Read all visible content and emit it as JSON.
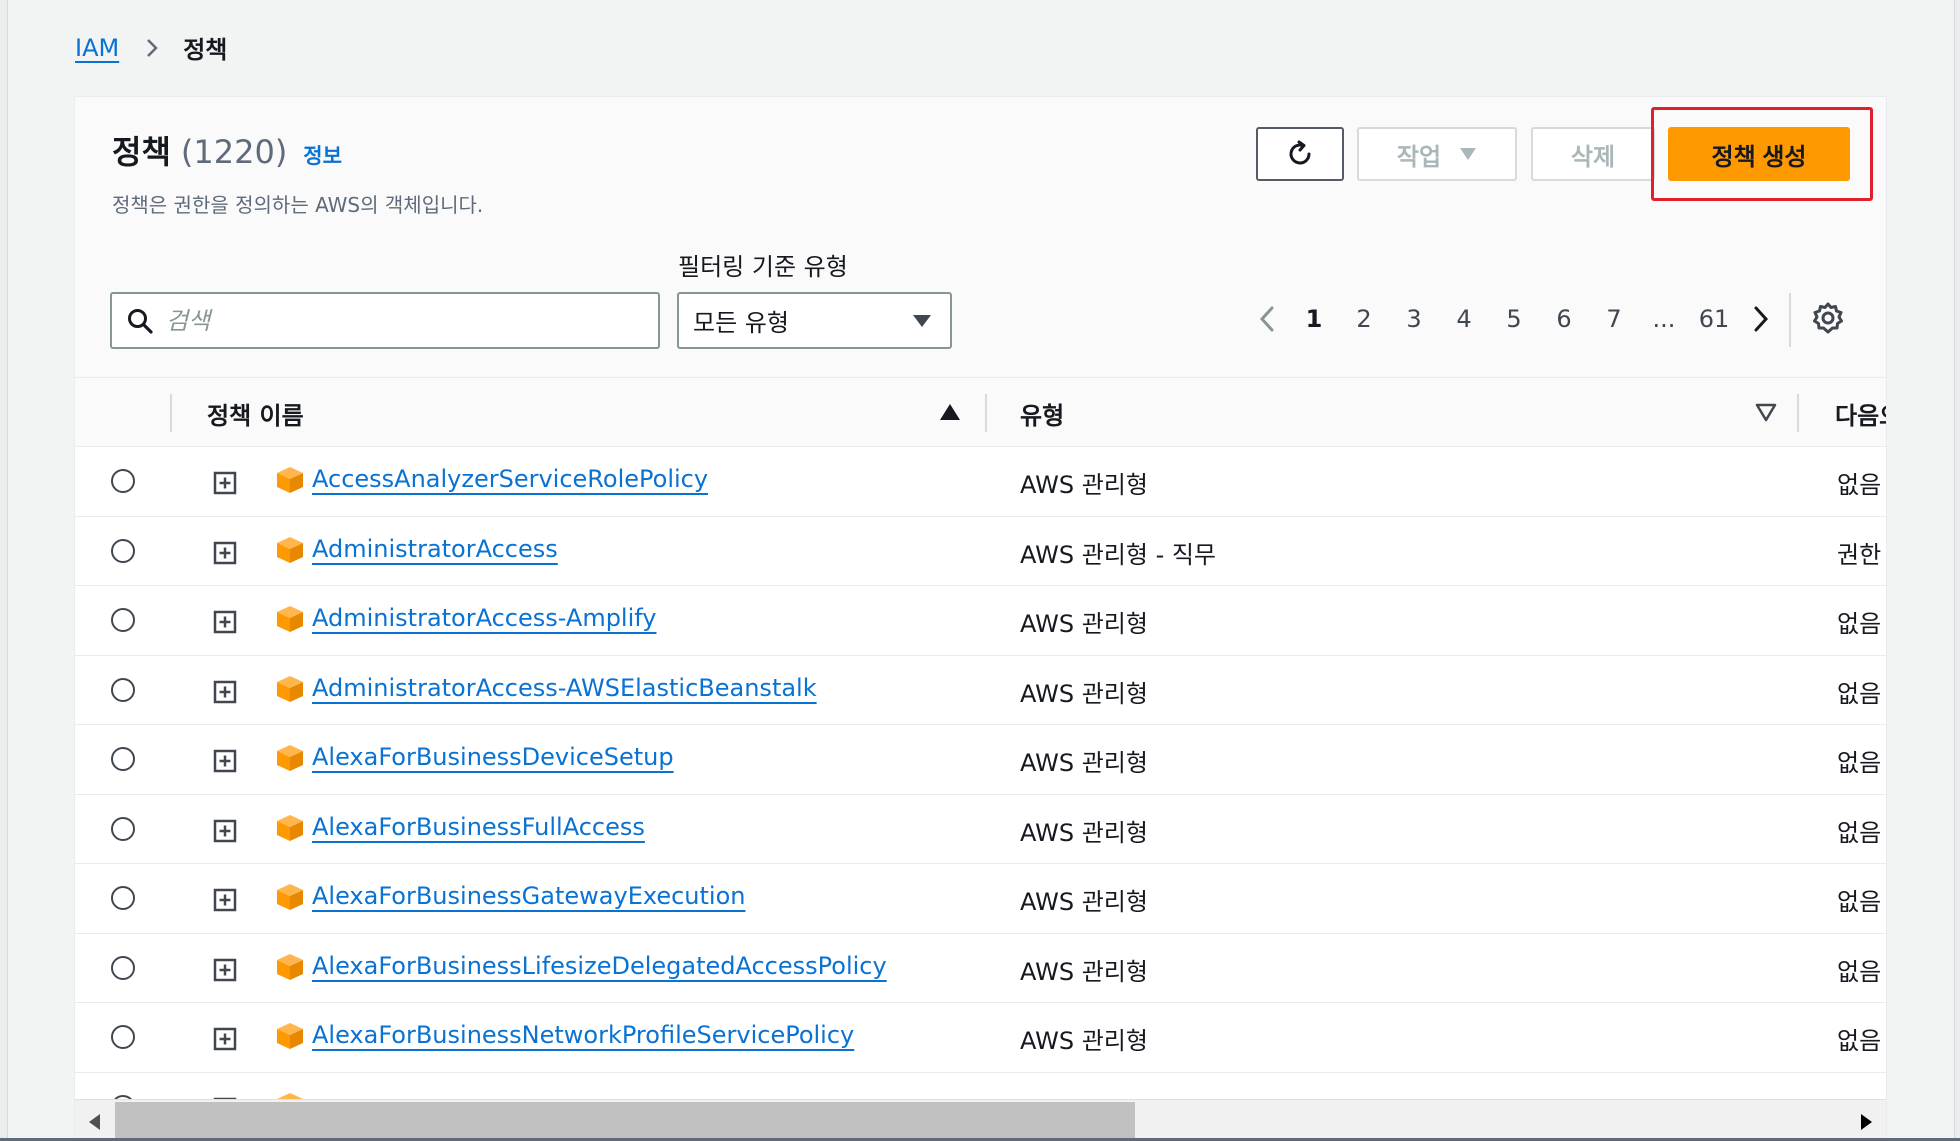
{
  "breadcrumb": {
    "root": "IAM",
    "current": "정책"
  },
  "panel": {
    "title": "정책",
    "count": "(1220)",
    "info_link": "정보",
    "subtitle": "정책은 권한을 정의하는 AWS의 객체입니다."
  },
  "toolbar": {
    "refresh_icon": "refresh-icon",
    "actions_label": "작업",
    "delete_label": "삭제",
    "create_label": "정책 생성"
  },
  "filter": {
    "label": "필터링 기준 유형",
    "search_placeholder": "검색",
    "type_selected": "모든 유형"
  },
  "pagination": {
    "pages": [
      "1",
      "2",
      "3",
      "4",
      "5",
      "6",
      "7",
      "...",
      "61"
    ],
    "current": "1"
  },
  "table": {
    "columns": {
      "name": "정책 이름",
      "type": "유형",
      "used": "다음으"
    },
    "rows": [
      {
        "name": "AccessAnalyzerServiceRolePolicy",
        "type": "AWS 관리형",
        "used": "없음"
      },
      {
        "name": "AdministratorAccess",
        "type": "AWS 관리형 - 직무",
        "used": "권한"
      },
      {
        "name": "AdministratorAccess-Amplify",
        "type": "AWS 관리형",
        "used": "없음"
      },
      {
        "name": "AdministratorAccess-AWSElasticBeanstalk",
        "type": "AWS 관리형",
        "used": "없음"
      },
      {
        "name": "AlexaForBusinessDeviceSetup",
        "type": "AWS 관리형",
        "used": "없음"
      },
      {
        "name": "AlexaForBusinessFullAccess",
        "type": "AWS 관리형",
        "used": "없음"
      },
      {
        "name": "AlexaForBusinessGatewayExecution",
        "type": "AWS 관리형",
        "used": "없음"
      },
      {
        "name": "AlexaForBusinessLifesizeDelegatedAccessPolicy",
        "type": "AWS 관리형",
        "used": "없음"
      },
      {
        "name": "AlexaForBusinessNetworkProfileServicePolicy",
        "type": "AWS 관리형",
        "used": "없음"
      }
    ]
  },
  "colors": {
    "link": "#0972d3",
    "primary_button": "#ff9900",
    "highlight": "#e0202a",
    "package_icon": "#ff9900"
  }
}
